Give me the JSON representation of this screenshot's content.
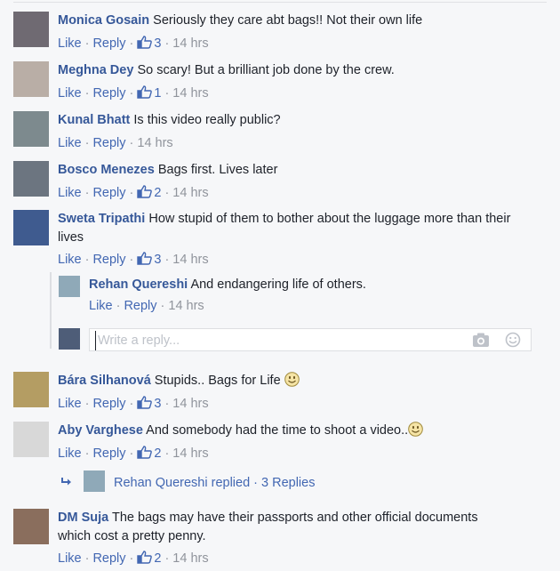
{
  "actions": {
    "like": "Like",
    "reply": "Reply",
    "dot": "·"
  },
  "comments": [
    {
      "name": "Monica Gosain",
      "text": "Seriously they care abt bags!! Not their own life",
      "likes": "3",
      "time": "14 hrs"
    },
    {
      "name": "Meghna Dey",
      "text": "So scary! But a brilliant job done by the crew.",
      "likes": "1",
      "time": "14 hrs"
    },
    {
      "name": "Kunal Bhatt",
      "text": "Is this video really public?",
      "likes": null,
      "time": "14 hrs"
    },
    {
      "name": "Bosco Menezes",
      "text": "Bags first. Lives later",
      "likes": "2",
      "time": "14 hrs"
    },
    {
      "name": "Sweta Tripathi",
      "text": "How stupid of them to bother about the luggage more than their lives",
      "likes": "3",
      "time": "14 hrs"
    },
    {
      "name": "Bára Silhanová",
      "text": "Stupids.. Bags for Life",
      "likes": "3",
      "time": "14 hrs",
      "emoji": "smiley"
    },
    {
      "name": "Aby Varghese",
      "text": "And somebody had the time to shoot a video..",
      "likes": "2",
      "time": "14 hrs",
      "emoji": "smiley"
    },
    {
      "name": "DM Suja",
      "text": "The bags may have their passports and other official documents which cost a pretty penny.",
      "likes": "2",
      "time": "14 hrs"
    }
  ],
  "reply": {
    "name": "Rehan Quereshi",
    "text": "And endangering life of others.",
    "time": "14 hrs"
  },
  "reply_input": {
    "placeholder": "Write a reply...",
    "icons": [
      "camera-icon",
      "smiley-icon"
    ]
  },
  "replied_summary": {
    "text": "Rehan Quereshi replied",
    "count": "3 Replies"
  },
  "colors": {
    "name": "#365899",
    "link": "#4267b2",
    "meta": "#90949c",
    "bg": "#f6f7f9"
  }
}
